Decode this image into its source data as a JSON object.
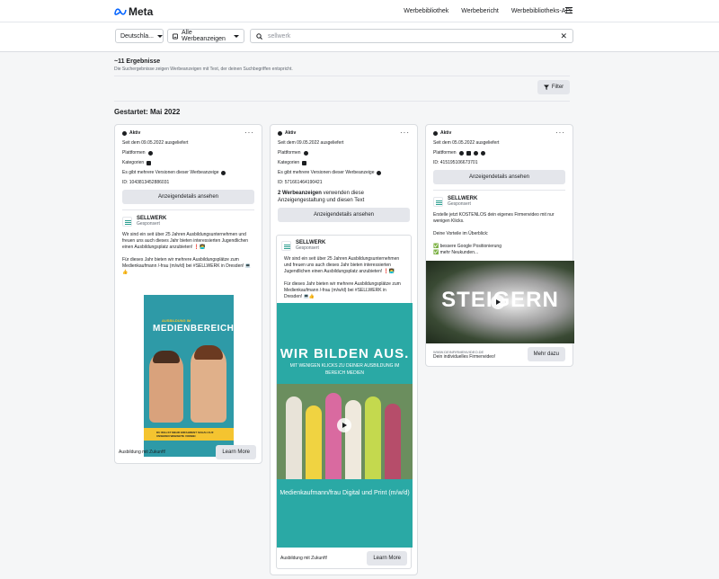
{
  "brand": {
    "name": "Meta"
  },
  "nav": {
    "items": [
      "Werbebibliothek",
      "Werbebericht",
      "Werbebibliotheks-API"
    ]
  },
  "search": {
    "country": "Deutschla...",
    "ad_category": "Alle Werbeanzeigen",
    "query": "sellwerk"
  },
  "results": {
    "count": "~11 Ergebnisse",
    "subtitle": "Die Suchergebnisse zeigen Werbeanzeigen mit Text, der deinen Suchbegriffen entspricht.",
    "filter_label": "Filter"
  },
  "section": {
    "title": "Gestartet: Mai 2022"
  },
  "cards": [
    {
      "status": "Aktiv",
      "since": "Seit dem 09.05.2022 ausgeliefert",
      "platforms_label": "Plattformen",
      "categories_label": "Kategorien",
      "versions": "Es gibt mehrere Versionen dieser Werbeanzeige",
      "id": "ID: 1043813452886031",
      "details_button": "Anzeigendetails ansehen",
      "advertiser": "SELLWERK",
      "sponsored": "Gesponsert",
      "body": "Wir sind ein seit über 25 Jahren Ausbildungsunternehmen und freuen uns auch dieses Jahr bieten interessierten Jugendlichen einen Ausbildungsplatz anzubieten! ❗👨‍💻\n\nFür dieses Jahr bieten wir mehrere Ausbildungsplätze zum Medienkaufmann /-frau (m/w/d) bei #SELLWERK in Dresden! 💻👍",
      "media_top": "AUSBILDUNG IM",
      "media_title": "MEDIENBEREICH",
      "media_banner": "DU WILLST MEHR ERFAHREN? SCHAU AUF UNSEREN WEBSEITE VORBEI",
      "caption": "Ausbildung mit Zukunft!",
      "cta": "Learn More"
    },
    {
      "status": "Aktiv",
      "since": "Seit dem 09.05.2022 ausgeliefert",
      "platforms_label": "Plattformen",
      "categories_label": "Kategorien",
      "versions": "Es gibt mehrere Versionen dieser Werbeanzeige",
      "id": "ID: 571661464190421",
      "variants_bold": "2 Werbeanzeigen",
      "variants_rest": " verwenden diese Anzeigengestaltung und diesen Text",
      "details_button": "Anzeigendetails ansehen",
      "advertiser": "SELLWERK",
      "sponsored": "Gesponsert",
      "body": "Wir sind ein seit über 25 Jahren Ausbildungsunternehmen und freuen uns auch dieses Jahr bieten interessierten Jugendlichen einen Ausbildungsplatz anzubieten! ❗👨‍💻\n\nFür dieses Jahr bieten wir mehrere Ausbildungsplätze zum Medienkaufmann /-frau (m/w/d) bei #SELLWERK in Dresden! 💻👍",
      "media_title": "WIR BILDEN AUS.",
      "media_sub": "MIT WENIGEN KLICKS ZU DEINER AUSBILDUNG IM BEREICH MEDIEN",
      "media_bottom": "Medienkaufmann/frau Digital und Print (m/w/d)",
      "caption": "Ausbildung mit Zukunft!",
      "cta": "Learn More"
    },
    {
      "status": "Aktiv",
      "since": "Seit dem 05.05.2022 ausgeliefert",
      "platforms_label": "Plattformen",
      "id": "ID: 415195106673701",
      "details_button": "Anzeigendetails ansehen",
      "advertiser": "SELLWERK",
      "sponsored": "Gesponsert",
      "body": "Erstelle jetzt KOSTENLOS dein eigenes Firmenvideo mit nur wenigen Klicks.\n\nDeine Vorteile im Überblick:\n\n✅ bessere Google Positionierung\n✅ mehr Neukunden...",
      "media_title": "STEIGERN",
      "domain": "WWW.DEINFIRMENVIDEO.DE",
      "caption": "Dein individuelles Firmenvideo!",
      "cta": "Mehr dazu"
    }
  ]
}
